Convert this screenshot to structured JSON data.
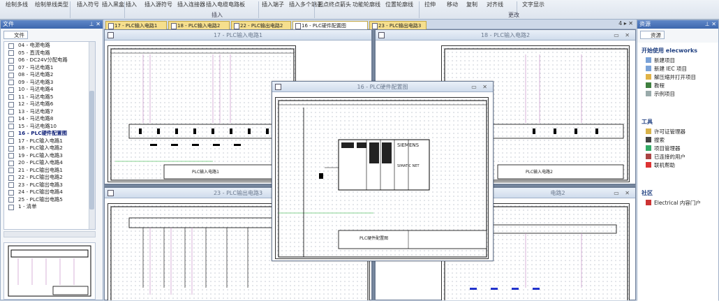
{
  "ribbon": {
    "buttons": [
      "绘制多线",
      "绘制单线类型",
      "插入符号",
      "插入黑盒",
      "插入\nPLC",
      "插入源符号",
      "插入连接器",
      "插入电缆电路板",
      "插入端子",
      "插入多个端子",
      "起点终点箭头",
      "功能轮廓线",
      "位置轮廓线",
      "拉伸",
      "移动",
      "复制",
      "对齐线",
      "文字显示"
    ],
    "groups": [
      "插入",
      "更改"
    ]
  },
  "left": {
    "title": "文件",
    "tab": "文件",
    "items": [
      "04 - 电源电路",
      "05 - 直流电路",
      "06 - DC24V分配电路",
      "07 - 马达电路1",
      "08 - 马达电路2",
      "09 - 马达电路3",
      "10 - 马达电路4",
      "11 - 马达电路5",
      "12 - 马达电路6",
      "13 - 马达电路7",
      "14 - 马达电路8",
      "15 - 马达电路10",
      "16 - PLC硬件配置图",
      "17 - PLC输入电路1",
      "18 - PLC输入电路2",
      "19 - PLC输入电路3",
      "20 - PLC输入电路4",
      "21 - PLC输出电路1",
      "22 - PLC输出电路2",
      "23 - PLC输出电路3",
      "24 - PLC输出电路4",
      "25 - PLC输出电路5",
      "1 - 清单"
    ],
    "active_index": 12
  },
  "tabs": [
    "17 - PLC输入电路1",
    "18 - PLC输入电路2",
    "22 - PLC输出电路2",
    "16 - PLC硬件配置图",
    "23 - PLC输出电路3"
  ],
  "active_tab": 3,
  "windows": {
    "w17": "17 - PLC输入电路1",
    "w18": "18 - PLC输入电路2",
    "w16": "16 - PLC硬件配置图",
    "w23": "23 - PLC输出电路3",
    "w22": "电路2"
  },
  "sheet_texts": {
    "w17": "PLC输入电路1",
    "w18": "PLC输入电路2",
    "w16": "PLC硬件配置图",
    "brand": "SIEMENS",
    "sub": "SIMATIC NET"
  },
  "right": {
    "title": "资源",
    "tab": "资源",
    "start_title": "开始使用 elecworks",
    "start_items": [
      "新建项目",
      "新建 IEC 项目",
      "解压缩并打开项目",
      "教程",
      "示例项目"
    ],
    "tools_title": "工具",
    "tools_items": [
      "许可证管理器",
      "搜索",
      "项目管理器",
      "已连接的用户",
      "联机帮助"
    ],
    "community_title": "社区",
    "community_items": [
      "Electrical 内容门户"
    ]
  },
  "colors": {
    "accent": "#3d67ad",
    "tab": "#f6df8d",
    "wire": "#c792c8",
    "green": "#5cc26a"
  }
}
